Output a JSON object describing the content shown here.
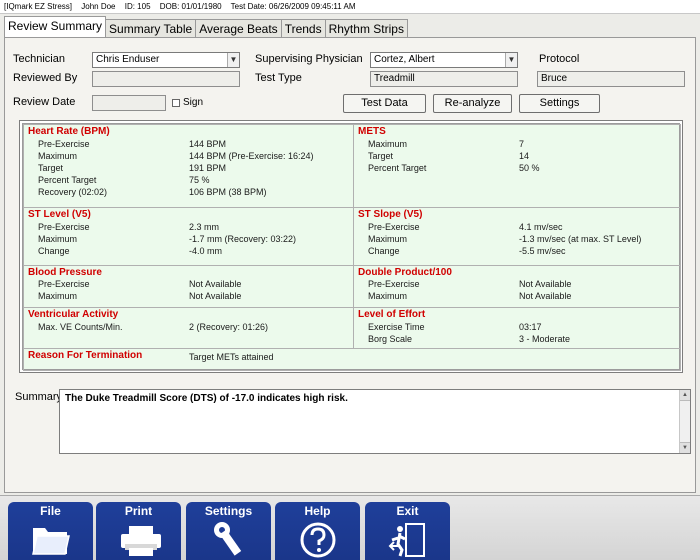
{
  "titlebar": {
    "app": "[IQmark EZ Stress]",
    "patient": "John Doe",
    "id": "ID: 105",
    "dob": "DOB: 01/01/1980",
    "test_date": "Test Date: 06/26/2009 09:45:11 AM"
  },
  "tabs": [
    "Review Summary",
    "Summary Table",
    "Average Beats",
    "Trends",
    "Rhythm Strips"
  ],
  "form": {
    "technician_label": "Technician",
    "technician_value": "Chris Enduser",
    "supervising_label": "Supervising Physician",
    "supervising_value": "Cortez, Albert",
    "protocol_label": "Protocol",
    "protocol_value": "Bruce",
    "reviewed_by_label": "Reviewed By",
    "reviewed_by_value": "",
    "test_type_label": "Test Type",
    "test_type_value": "Treadmill",
    "review_date_label": "Review Date",
    "review_date_value": "",
    "sign_label": "Sign",
    "test_data_btn": "Test Data",
    "reanalyze_btn": "Re-analyze",
    "settings_btn": "Settings"
  },
  "results": {
    "heart_rate": {
      "title": "Heart Rate (BPM)",
      "rows": [
        {
          "label": "Pre-Exercise",
          "value": "144 BPM"
        },
        {
          "label": "Maximum",
          "value": "144 BPM (Pre-Exercise: 16:24)"
        },
        {
          "label": "Target",
          "value": "191 BPM"
        },
        {
          "label": "Percent Target",
          "value": "75 %"
        },
        {
          "label": "Recovery (02:02)",
          "value": "106 BPM (38 BPM)"
        }
      ]
    },
    "mets": {
      "title": "METS",
      "rows": [
        {
          "label": "Maximum",
          "value": "7"
        },
        {
          "label": "Target",
          "value": "14"
        },
        {
          "label": "Percent Target",
          "value": "50 %"
        }
      ]
    },
    "st_level": {
      "title": "ST Level (V5)",
      "rows": [
        {
          "label": "Pre-Exercise",
          "value": "2.3 mm"
        },
        {
          "label": "Maximum",
          "value": "-1.7 mm (Recovery: 03:22)"
        },
        {
          "label": "Change",
          "value": "-4.0 mm"
        }
      ]
    },
    "st_slope": {
      "title": "ST Slope (V5)",
      "rows": [
        {
          "label": "Pre-Exercise",
          "value": "4.1 mv/sec"
        },
        {
          "label": "Maximum",
          "value": "-1.3 mv/sec (at max. ST Level)"
        },
        {
          "label": "Change",
          "value": "-5.5 mv/sec"
        }
      ]
    },
    "blood_pressure": {
      "title": "Blood Pressure",
      "rows": [
        {
          "label": "Pre-Exercise",
          "value": "Not Available"
        },
        {
          "label": "Maximum",
          "value": "Not Available"
        }
      ]
    },
    "double_product": {
      "title": "Double Product/100",
      "rows": [
        {
          "label": "Pre-Exercise",
          "value": "Not Available"
        },
        {
          "label": "Maximum",
          "value": "Not Available"
        }
      ]
    },
    "ventricular": {
      "title": "Ventricular Activity",
      "rows": [
        {
          "label": "Max. VE Counts/Min.",
          "value": "2 (Recovery: 01:26)"
        }
      ]
    },
    "effort": {
      "title": "Level of Effort",
      "rows": [
        {
          "label": "Exercise Time",
          "value": "03:17"
        },
        {
          "label": "Borg Scale",
          "value": "3 - Moderate"
        }
      ]
    },
    "termination": {
      "title": "Reason For Termination",
      "value": "Target METs attained"
    }
  },
  "summary": {
    "label": "Summary:",
    "text": "The Duke Treadmill Score (DTS) of -17.0 indicates high risk."
  },
  "bottom_buttons": [
    "File",
    "Print",
    "Settings",
    "Help",
    "Exit"
  ]
}
